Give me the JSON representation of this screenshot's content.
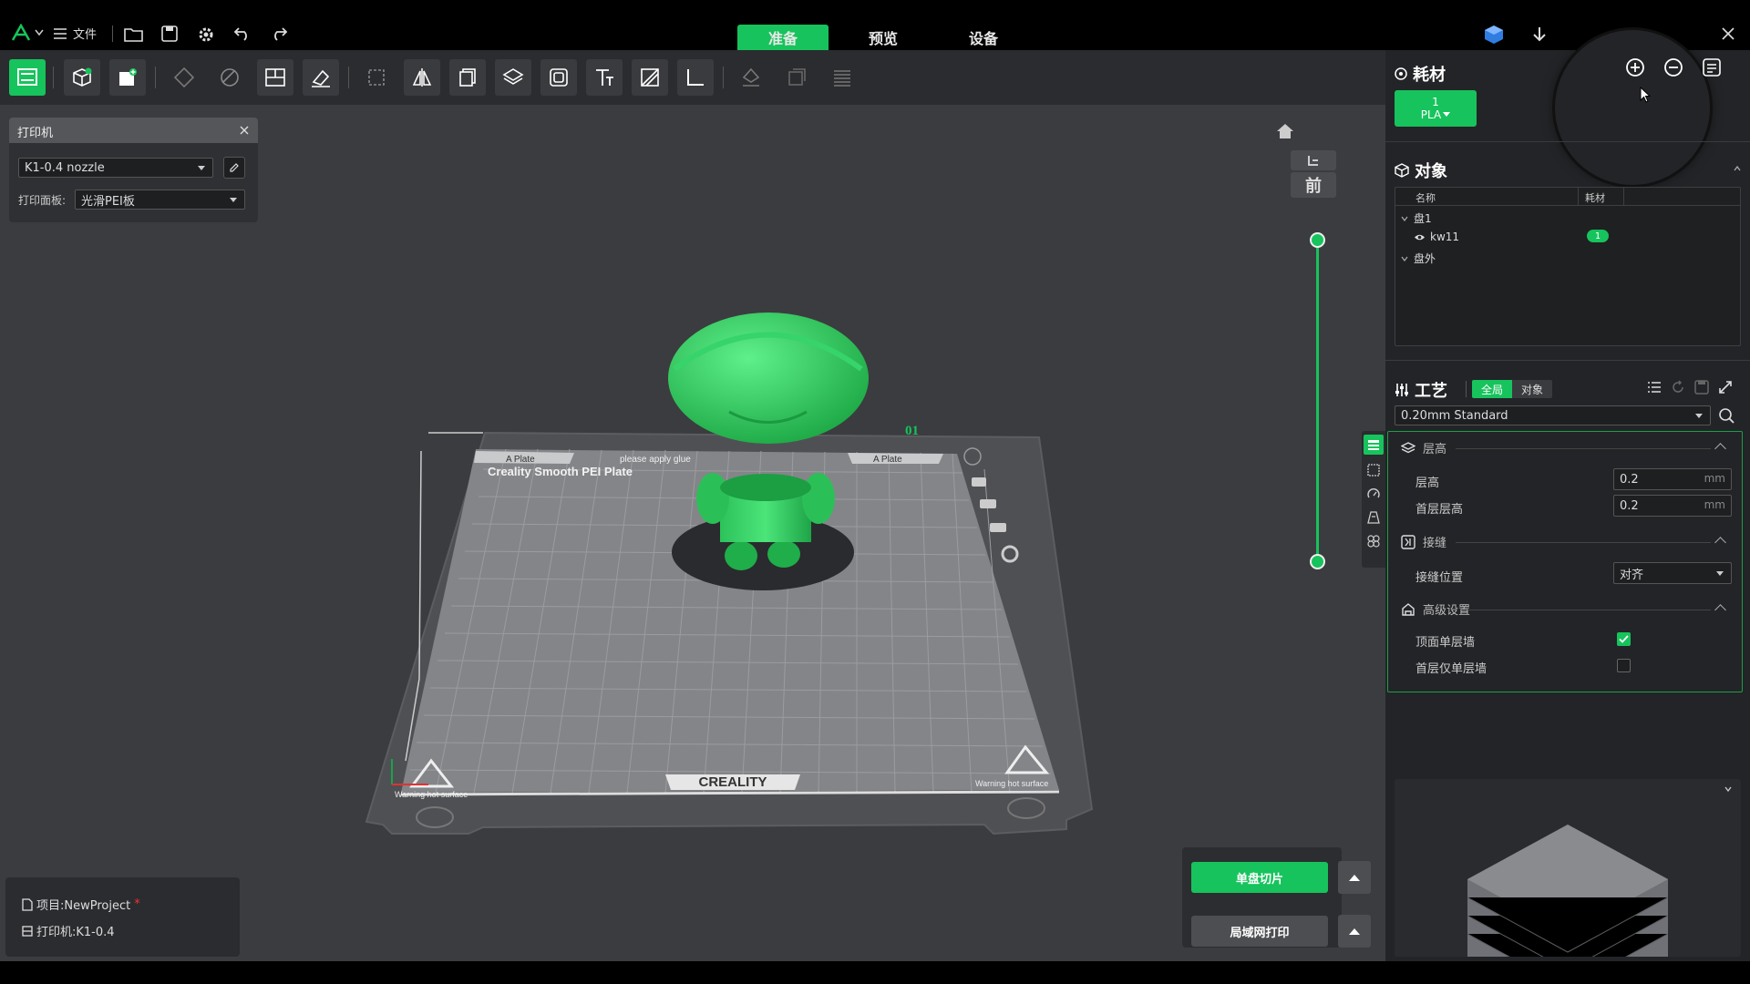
{
  "titlebar": {
    "file_menu": "文件",
    "tabs": [
      {
        "label": "准备",
        "active": true
      },
      {
        "label": "预览",
        "active": false
      },
      {
        "label": "设备",
        "active": false
      }
    ]
  },
  "printer_panel": {
    "title": "打印机",
    "printer_select": "K1-0.4 nozzle",
    "plate_label": "打印面板:",
    "plate_select": "光滑PEI板"
  },
  "plate": {
    "name": "Creality Smooth PEI Plate",
    "plate_number": "01",
    "brand": "CREALITY",
    "tab_left": "A Plate",
    "tab_right": "A Plate",
    "tab_middle": "please apply glue",
    "warning_left": "Warning hot surface",
    "warning_right": "Warning hot surface"
  },
  "view_controls": {
    "front_view_label": "前"
  },
  "slice_buttons": {
    "slice_single": "单盘切片",
    "lan_print": "局域网打印"
  },
  "project_info": {
    "project_label": "项目:NewProject",
    "modified_mark": "*",
    "printer_label": "打印机:K1-0.4"
  },
  "filament": {
    "title": "耗材",
    "slot_index": "1",
    "slot_material": "PLA",
    "slot_color": "#17c35c"
  },
  "objects": {
    "title": "对象",
    "columns": [
      "名称",
      "耗材"
    ],
    "plate_group": "盘1",
    "object_name": "kw11",
    "object_filament": "1",
    "outside_group": "盘外"
  },
  "process": {
    "title": "工艺",
    "toggle_global": "全局",
    "toggle_object": "对象",
    "preset": "0.20mm Standard",
    "groups": {
      "layer_height": {
        "title": "层高",
        "layer_height_label": "层高",
        "layer_height_value": "0.2",
        "first_layer_label": "首层层高",
        "first_layer_value": "0.2",
        "unit": "mm"
      },
      "seam": {
        "title": "接缝",
        "seam_position_label": "接缝位置",
        "seam_position_value": "对齐"
      },
      "advanced": {
        "title": "高级设置",
        "top_single_wall_label": "顶面单层墙",
        "top_single_wall_checked": true,
        "first_layer_single_wall_label": "首层仅单层墙",
        "first_layer_single_wall_checked": false
      }
    }
  },
  "colors": {
    "accent": "#17c35c",
    "panel_bg": "#232427",
    "viewport_bg": "#3b3c3f"
  }
}
